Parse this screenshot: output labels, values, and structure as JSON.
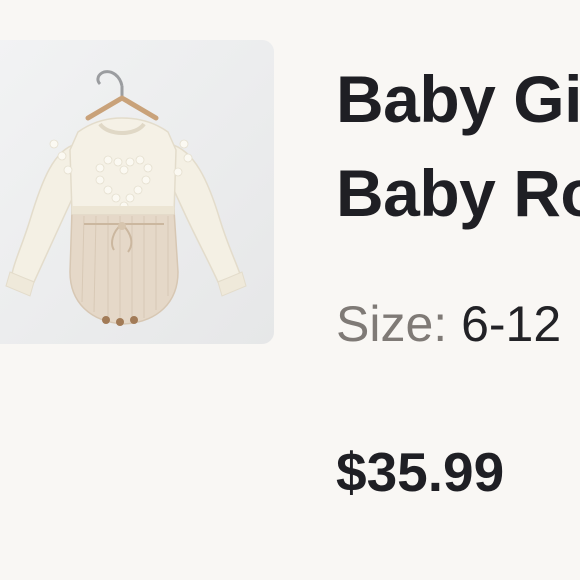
{
  "product": {
    "image_icon": "baby-romper-photo",
    "title_line_1": "Baby Gi",
    "title_line_2": "Baby Ro",
    "size_label": "Size:",
    "size_value": "6-12",
    "price": "$35.99"
  },
  "colors": {
    "background": "#f9f7f4",
    "image_background": "#eff0f1",
    "sweater": "#f4f0e4",
    "romper": "#e5d8c8",
    "text_primary": "#1f1f24",
    "text_muted": "#7f7a76"
  }
}
